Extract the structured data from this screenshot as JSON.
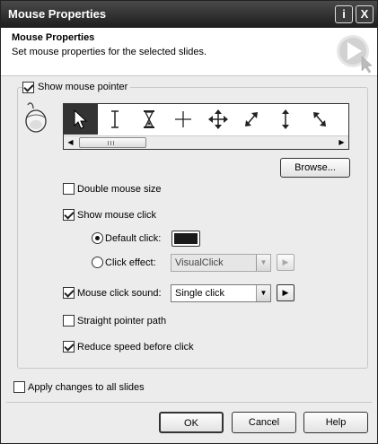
{
  "window": {
    "title": "Mouse Properties",
    "info_button": "i",
    "close_button": "X"
  },
  "header": {
    "title": "Mouse Properties",
    "description": "Set mouse properties for the selected slides."
  },
  "show_pointer": {
    "label": "Show mouse pointer",
    "checked": true
  },
  "cursors": {
    "items": [
      "arrow-cursor-icon",
      "ibeam-cursor-icon",
      "hourglass-cursor-icon",
      "crosshair-cursor-icon",
      "move-cursor-icon",
      "resize-diagonal-ne-icon",
      "resize-vertical-icon",
      "resize-diagonal-nw-icon"
    ],
    "selected": "arrow-cursor-icon",
    "browse_label": "Browse..."
  },
  "options": {
    "double_size": {
      "label": "Double mouse size",
      "checked": false
    },
    "show_click": {
      "label": "Show mouse click",
      "checked": true
    },
    "default_click": {
      "label": "Default click:",
      "selected": true,
      "color": "#1a1a1a"
    },
    "click_effect": {
      "label": "Click effect:",
      "selected": false,
      "value": "VisualClick"
    },
    "click_sound": {
      "label": "Mouse click sound:",
      "checked": true,
      "value": "Single click"
    },
    "straight_path": {
      "label": "Straight pointer path",
      "checked": false
    },
    "reduce_speed": {
      "label": "Reduce speed before click",
      "checked": true
    }
  },
  "apply_all": {
    "label": "Apply changes to all slides",
    "checked": false
  },
  "buttons": {
    "ok": "OK",
    "cancel": "Cancel",
    "help": "Help"
  }
}
